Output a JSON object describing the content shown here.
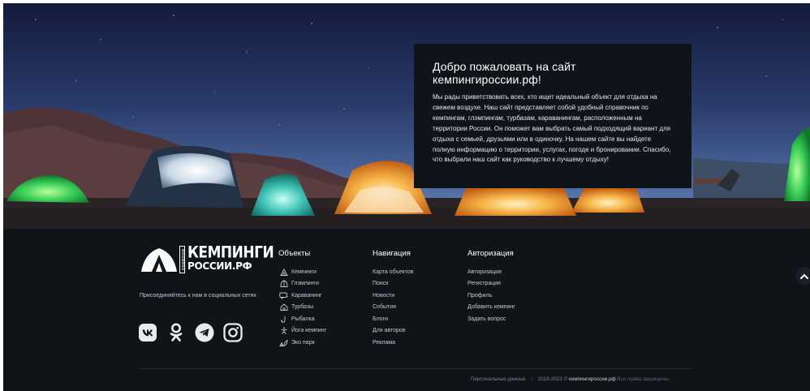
{
  "welcome": {
    "title": "Добро пожаловать на сайт кемпингироссии.рф!",
    "text": "Мы рады приветствовать всех, кто ищет идеальный объект для отдыха на свежем воздухе. Наш сайт представляет собой удобный справочник по кемпингам, глэмпингам, турбазам, караванингам, расположенным на территории России. Он поможет вам выбрать самый подходящий вариант для отдыха с семьей, друзьями или в одиночку. На нашем сайте вы найдете полную информацию о территории, услугах, погоде и бронировании. Спасибо, что выбрали наш сайт как руководство к лучшему отдыху!"
  },
  "logo": {
    "line1": "КЕМПИНГИ",
    "line2": "РОССИИ.РФ",
    "vertical": "справочник"
  },
  "social": {
    "text": "Присоединяйтесь к нам в социальных сетях",
    "icons": [
      "vk-icon",
      "odnoklassniki-icon",
      "telegram-icon",
      "instagram-icon"
    ]
  },
  "objects": {
    "title": "Объекты",
    "items": [
      {
        "label": "Кемпинги",
        "icon": "tent-icon"
      },
      {
        "label": "Глэмпинги",
        "icon": "glamping-icon"
      },
      {
        "label": "Караванинг",
        "icon": "caravan-icon"
      },
      {
        "label": "Турбазы",
        "icon": "house-icon"
      },
      {
        "label": "Рыбалка",
        "icon": "fish-hook-icon"
      },
      {
        "label": "Йога кемпинг",
        "icon": "yoga-icon"
      },
      {
        "label": "Эко парк",
        "icon": "eco-park-icon"
      }
    ]
  },
  "navigation": {
    "title": "Навигация",
    "items": [
      "Карта объектов",
      "Поиск",
      "Новости",
      "События",
      "Блоги",
      "Для авторов",
      "Реклама"
    ]
  },
  "auth": {
    "title": "Авторизация",
    "items": [
      "Авторизация",
      "Регистрация",
      "Профиль",
      "Добавить кемпинг",
      "Задать вопрос"
    ]
  },
  "footer_bottom": {
    "personal_data": "Персональные данные",
    "separator": "|",
    "copyright": "2018-2023 ©",
    "site": "кемпингироссии.рф",
    "rights": "Все права защищены."
  },
  "colors": {
    "footer_bg": "#0f1419",
    "panel_bg": "#0e1419",
    "tent_green": "#3ad15a",
    "tent_orange": "#f39a2b"
  }
}
